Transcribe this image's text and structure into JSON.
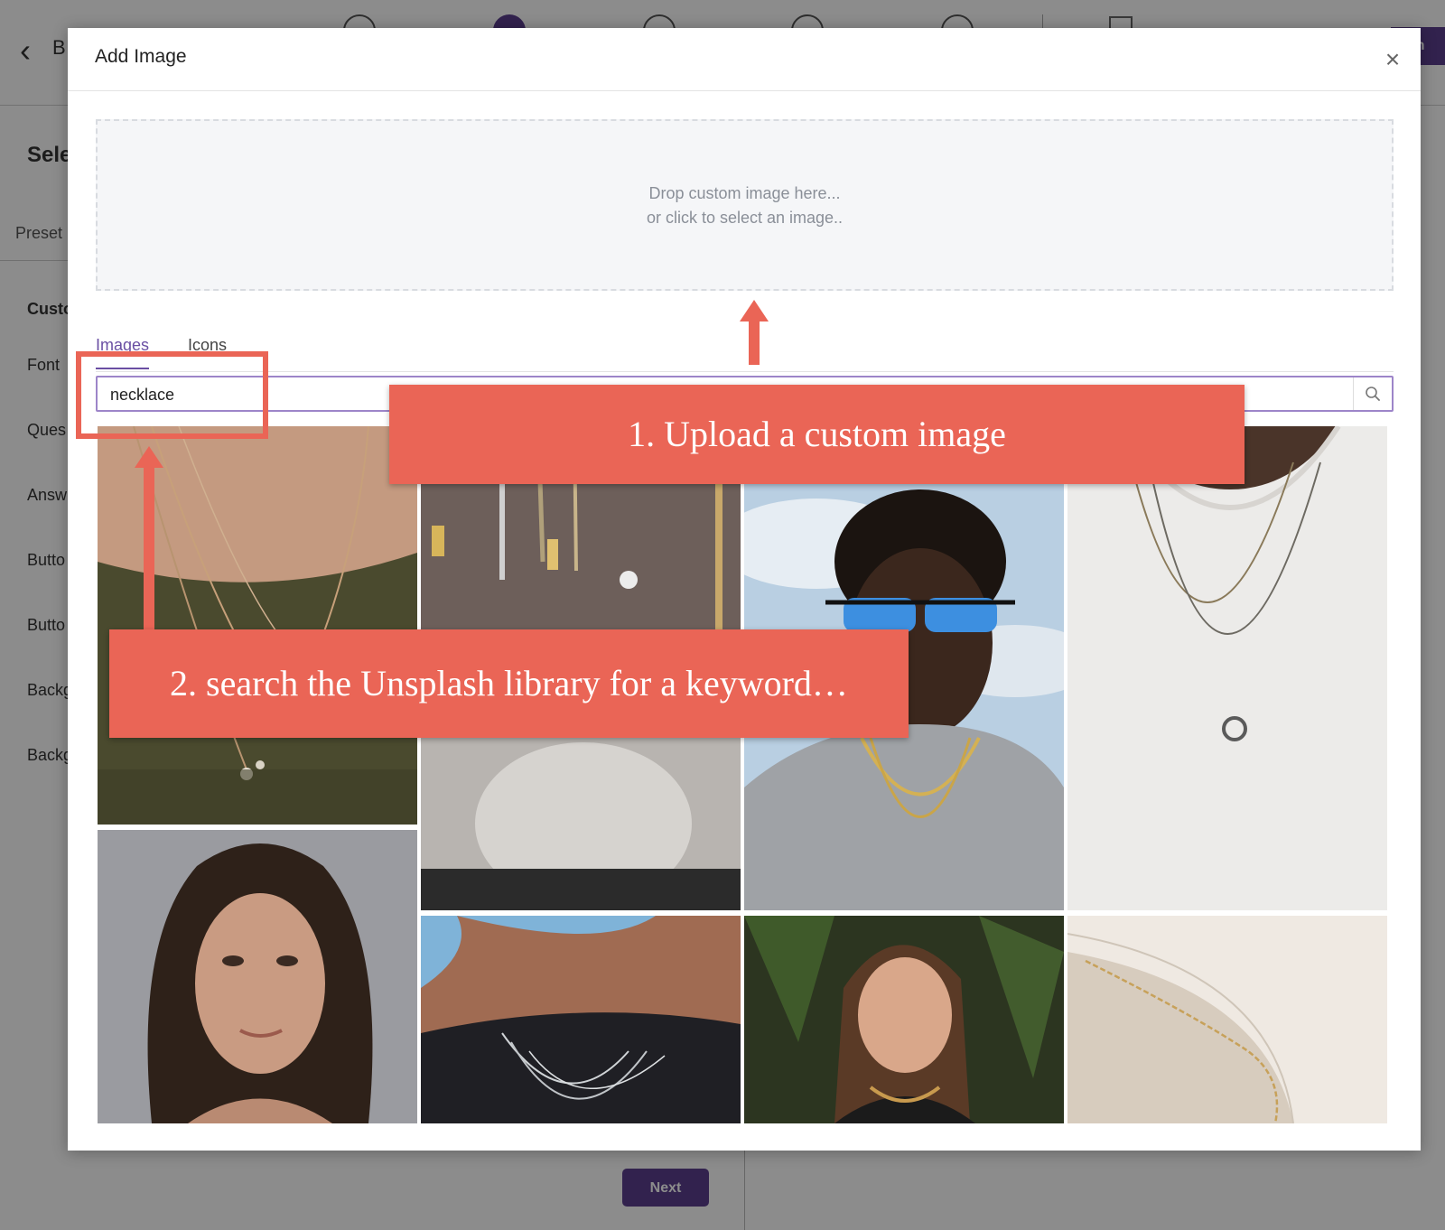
{
  "app": {
    "back_label": "B",
    "panel_title": "Sele",
    "preset_label": "Preset",
    "custom_heading": "Custo",
    "settings_labels": [
      "Font",
      "Ques",
      "Answ",
      "Butto",
      "Butto",
      "Backg",
      "Backg"
    ],
    "next_button": "Next",
    "publish_button": "lish",
    "accent_color": "#5b3f8f"
  },
  "modal": {
    "title": "Add Image",
    "close_icon": "close-icon",
    "dropzone": {
      "line1": "Drop custom image here...",
      "line2": "or click to select an image.."
    },
    "tabs": [
      {
        "label": "Images",
        "active": true
      },
      {
        "label": "Icons",
        "active": false
      }
    ],
    "search": {
      "value": "necklace",
      "icon": "search-icon"
    }
  },
  "annotations": {
    "callout_1": "1. Upload a custom image",
    "callout_2": "2. search the Unsplash library for a keyword…",
    "callout_color": "#ea6556"
  }
}
